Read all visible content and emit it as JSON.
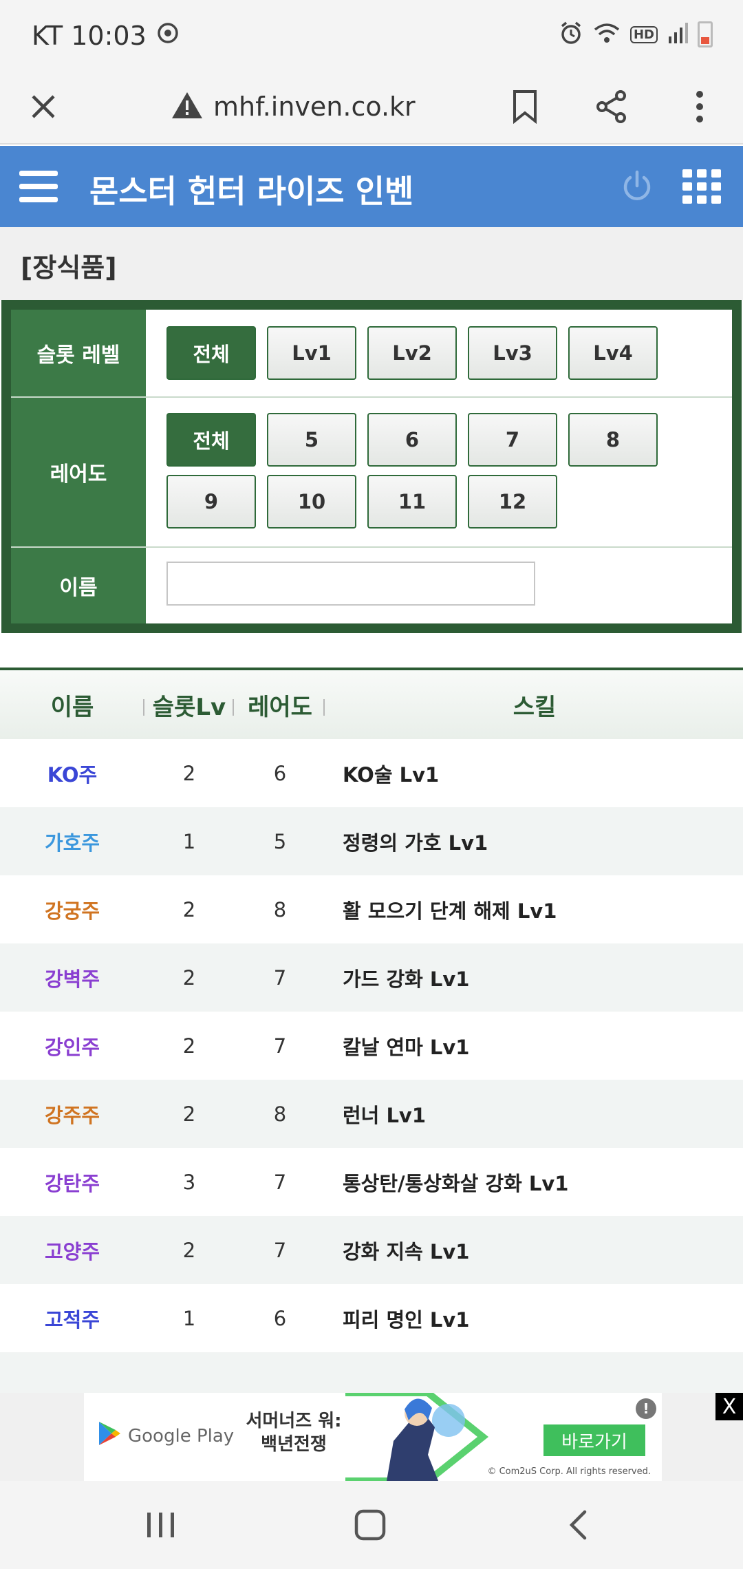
{
  "status_bar": {
    "carrier_time": "KT 10:03",
    "icons": [
      "sync-icon",
      "alarm-icon",
      "wifi-icon",
      "hd-icon",
      "signal-icon",
      "battery-icon"
    ],
    "hd_label": "HD"
  },
  "browser": {
    "url": "mhf.inven.co.kr",
    "icons": [
      "close-icon",
      "warning-icon",
      "bookmark-icon",
      "share-icon",
      "more-icon"
    ]
  },
  "site": {
    "title": "몬스터 헌터 라이즈 인벤",
    "brand_color": "#4a86d1"
  },
  "section_label": "[장식품]",
  "filters": {
    "slot_level": {
      "label": "슬롯 레벨",
      "options": [
        "전체",
        "Lv1",
        "Lv2",
        "Lv3",
        "Lv4"
      ],
      "selected": "전체"
    },
    "rarity": {
      "label": "레어도",
      "options": [
        "전체",
        "5",
        "6",
        "7",
        "8",
        "9",
        "10",
        "11",
        "12"
      ],
      "selected": "전체"
    },
    "name": {
      "label": "이름",
      "value": ""
    },
    "accent_color": "#356d3e"
  },
  "table": {
    "headers": [
      "이름",
      "슬롯Lv",
      "레어도",
      "스킬"
    ],
    "rows": [
      {
        "name": "KO주",
        "slot": "2",
        "rarity": "6",
        "skill": "KO술 Lv1",
        "color": "#3a46d6"
      },
      {
        "name": "가호주",
        "slot": "1",
        "rarity": "5",
        "skill": "정령의 가호 Lv1",
        "color": "#3b97dd"
      },
      {
        "name": "강궁주",
        "slot": "2",
        "rarity": "8",
        "skill": "활 모으기 단계 해제 Lv1",
        "color": "#d07421"
      },
      {
        "name": "강벽주",
        "slot": "2",
        "rarity": "7",
        "skill": "가드 강화 Lv1",
        "color": "#8a3fd1"
      },
      {
        "name": "강인주",
        "slot": "2",
        "rarity": "7",
        "skill": "칼날 연마 Lv1",
        "color": "#8a3fd1"
      },
      {
        "name": "강주주",
        "slot": "2",
        "rarity": "8",
        "skill": "런너 Lv1",
        "color": "#d07421"
      },
      {
        "name": "강탄주",
        "slot": "3",
        "rarity": "7",
        "skill": "통상탄/통상화살 강화 Lv1",
        "color": "#8a3fd1"
      },
      {
        "name": "고양주",
        "slot": "2",
        "rarity": "7",
        "skill": "강화 지속 Lv1",
        "color": "#8a3fd1"
      },
      {
        "name": "고적주",
        "slot": "1",
        "rarity": "6",
        "skill": "피리 명인 Lv1",
        "color": "#3a46d6"
      }
    ]
  },
  "ad": {
    "store": "Google Play",
    "title": "서머너즈 워: 백년전쟁",
    "cta": "바로가기",
    "copyright": "© Com2uS Corp. All rights reserved.",
    "info": "!",
    "close": "X"
  },
  "nav": {
    "icons": [
      "recent-apps-icon",
      "home-icon",
      "back-icon"
    ]
  }
}
